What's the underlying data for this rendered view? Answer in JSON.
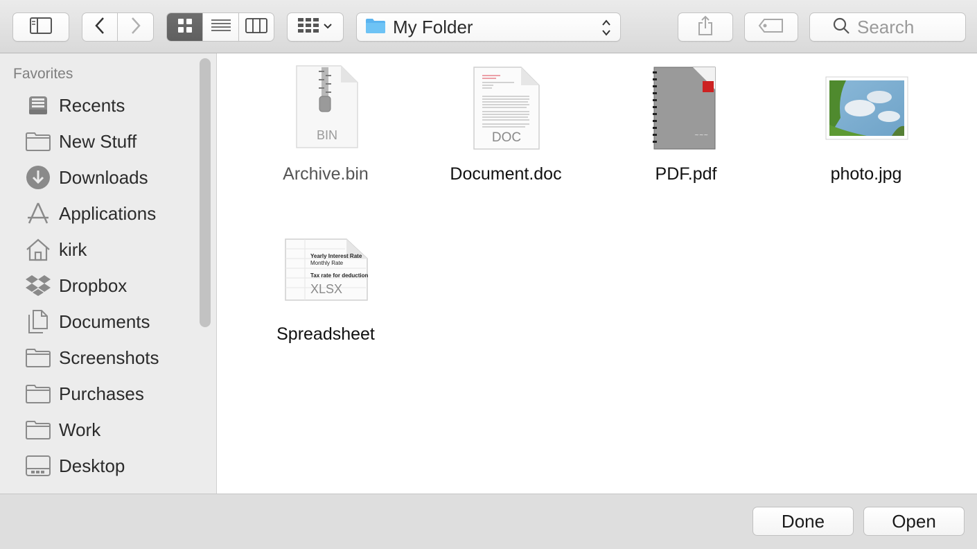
{
  "toolbar": {
    "path": {
      "label": "My Folder"
    },
    "search": {
      "placeholder": "Search"
    }
  },
  "sidebar": {
    "heading": "Favorites",
    "items": [
      {
        "label": "Recents",
        "icon": "recents-icon"
      },
      {
        "label": "New Stuff",
        "icon": "folder-icon"
      },
      {
        "label": "Downloads",
        "icon": "downloads-icon"
      },
      {
        "label": "Applications",
        "icon": "applications-icon"
      },
      {
        "label": "kirk",
        "icon": "home-icon"
      },
      {
        "label": "Dropbox",
        "icon": "dropbox-icon"
      },
      {
        "label": "Documents",
        "icon": "documents-icon"
      },
      {
        "label": "Screenshots",
        "icon": "folder-icon"
      },
      {
        "label": "Purchases",
        "icon": "folder-icon"
      },
      {
        "label": "Work",
        "icon": "folder-icon"
      },
      {
        "label": "Desktop",
        "icon": "desktop-icon"
      }
    ]
  },
  "files": [
    {
      "name": "Archive.bin",
      "badge": "BIN",
      "dimmed": true
    },
    {
      "name": "Document.doc",
      "badge": "DOC"
    },
    {
      "name": "PDF.pdf",
      "badge": ""
    },
    {
      "name": "photo.jpg",
      "badge": ""
    },
    {
      "name": "Spreadsheet",
      "badge": "XLSX",
      "lines": [
        "Yearly Interest Rate",
        "Monthly Rate",
        "Tax rate for deduction"
      ]
    }
  ],
  "buttons": {
    "done": "Done",
    "open": "Open"
  },
  "colors": {
    "folder": "#5ab4f0",
    "sidebar_icon": "#8a8a8a",
    "active_segment": "#666666"
  }
}
